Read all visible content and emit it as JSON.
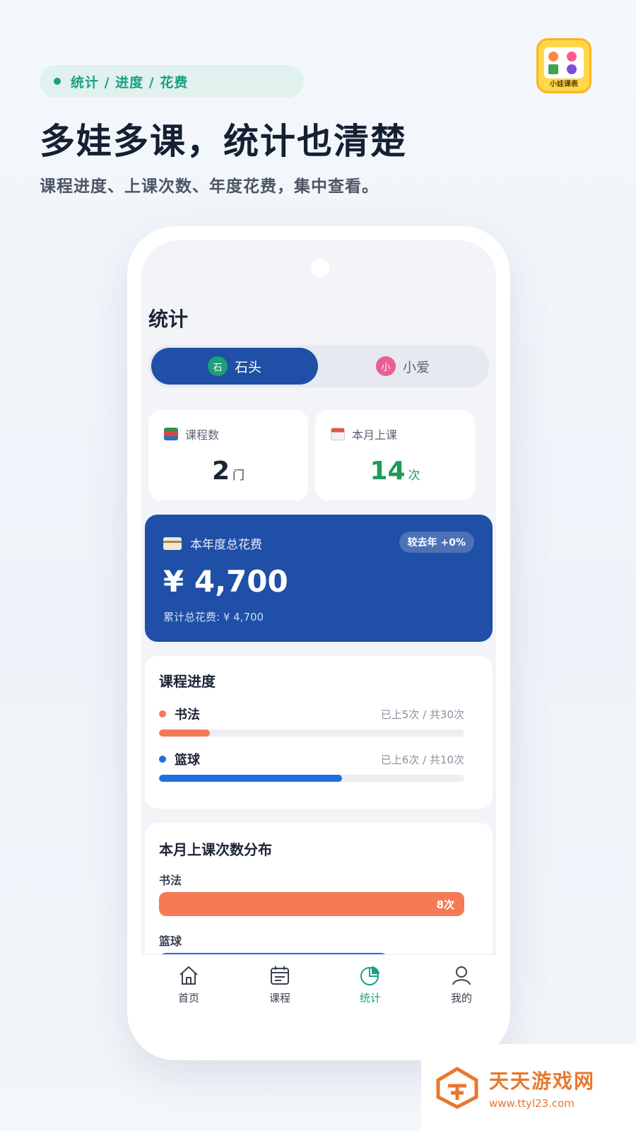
{
  "promo": {
    "tag": "统计 / 进度 / 花费",
    "headline": "多娃多课，统计也清楚",
    "subline": "课程进度、上课次数、年度花费，集中查看。",
    "app_name": "小娃课表"
  },
  "screen": {
    "title": "统计",
    "children": [
      {
        "avatar": "石",
        "name": "石头",
        "active": true,
        "color": "#1f9e7a"
      },
      {
        "avatar": "小",
        "name": "小爱",
        "active": false,
        "color": "#e85f94"
      }
    ],
    "stats": {
      "courses": {
        "label": "课程数",
        "value": "2",
        "unit": "门",
        "icon": "books-icon"
      },
      "month": {
        "label": "本月上课",
        "value": "14",
        "unit": "次",
        "icon": "calendar-icon",
        "color": "#1e9a56"
      }
    },
    "fee": {
      "label": "本年度总花费",
      "badge": "较去年 +0%",
      "amount": "¥ 4,700",
      "total": "累计总花费: ¥ 4,700"
    },
    "progress": {
      "title": "课程进度",
      "items": [
        {
          "name": "书法",
          "meta": "已上5次 / 共30次",
          "done": 5,
          "total": 30,
          "color": "#f47a55"
        },
        {
          "name": "篮球",
          "meta": "已上6次 / 共10次",
          "done": 6,
          "total": 10,
          "color": "#1f6fe0"
        }
      ]
    },
    "distribution": {
      "title": "本月上课次数分布",
      "items": [
        {
          "name": "书法",
          "count_label": "8次",
          "count": 8,
          "color": "#f47a55"
        },
        {
          "name": "篮球",
          "count_label": "",
          "count": 6,
          "color": "#1f6fe0"
        }
      ]
    },
    "tabs": [
      {
        "label": "首页",
        "icon": "home-icon",
        "active": false
      },
      {
        "label": "课程",
        "icon": "course-calendar-icon",
        "active": false
      },
      {
        "label": "统计",
        "icon": "pie-chart-icon",
        "active": true
      },
      {
        "label": "我的",
        "icon": "user-icon",
        "active": false
      }
    ]
  },
  "watermark": {
    "name": "天天游戏网",
    "url": "www.ttyl23.com"
  }
}
